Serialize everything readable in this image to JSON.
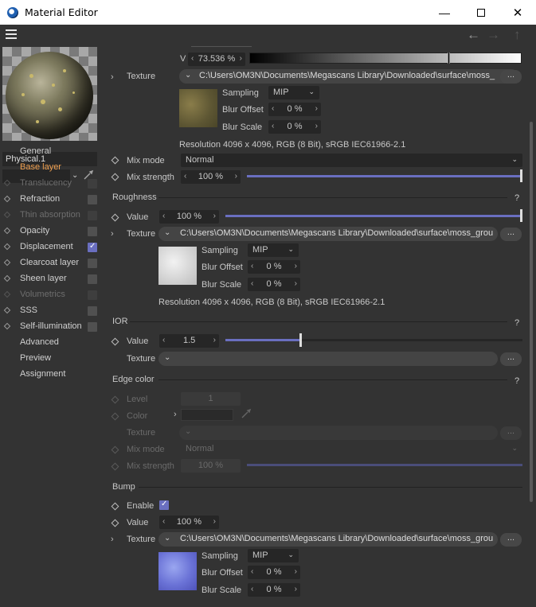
{
  "window": {
    "title": "Material Editor"
  },
  "material": {
    "name": "Physical.1"
  },
  "sidebar": {
    "items": [
      {
        "label": "General",
        "state": "normal"
      },
      {
        "label": "Base layer",
        "state": "active"
      },
      {
        "label": "Translucency",
        "state": "disabled"
      },
      {
        "label": "Refraction",
        "state": "normal"
      },
      {
        "label": "Thin absorption",
        "state": "disabled"
      },
      {
        "label": "Opacity",
        "state": "normal"
      },
      {
        "label": "Displacement",
        "state": "normal",
        "checked": true
      },
      {
        "label": "Clearcoat layer",
        "state": "normal"
      },
      {
        "label": "Sheen layer",
        "state": "normal"
      },
      {
        "label": "Volumetrics",
        "state": "disabled"
      },
      {
        "label": "SSS",
        "state": "normal"
      },
      {
        "label": "Self-illumination",
        "state": "normal"
      },
      {
        "label": "Advanced",
        "state": "normal"
      },
      {
        "label": "Preview",
        "state": "normal"
      },
      {
        "label": "Assignment",
        "state": "normal"
      }
    ]
  },
  "base": {
    "v_label": "V",
    "v_value": "73.536 %",
    "v_fraction": 0.735,
    "texture_label": "Texture",
    "texture_path": "C:\\Users\\OM3N\\Documents\\Megascans Library\\Downloaded\\surface\\moss_",
    "sampling_label": "Sampling",
    "sampling_value": "MIP",
    "blur_offset_label": "Blur Offset",
    "blur_offset_value": "0 %",
    "blur_scale_label": "Blur Scale",
    "blur_scale_value": "0 %",
    "resolution": "Resolution 4096 x 4096, RGB (8 Bit), sRGB IEC61966-2.1",
    "mix_mode_label": "Mix mode",
    "mix_mode_value": "Normal",
    "mix_strength_label": "Mix strength",
    "mix_strength_value": "100 %",
    "mix_strength_fraction": 1.0,
    "more": "..."
  },
  "roughness": {
    "title": "Roughness",
    "help": "?",
    "value_label": "Value",
    "value": "100 %",
    "fraction": 1.0,
    "texture_label": "Texture",
    "texture_path": "C:\\Users\\OM3N\\Documents\\Megascans Library\\Downloaded\\surface\\moss_grou",
    "sampling_label": "Sampling",
    "sampling_value": "MIP",
    "blur_offset_label": "Blur Offset",
    "blur_offset_value": "0 %",
    "blur_scale_label": "Blur Scale",
    "blur_scale_value": "0 %",
    "resolution": "Resolution 4096 x 4096, RGB (8 Bit), sRGB IEC61966-2.1",
    "more": "..."
  },
  "ior": {
    "title": "IOR",
    "help": "?",
    "value_label": "Value",
    "value": "1.5",
    "fraction": 0.25,
    "texture_label": "Texture",
    "more": "..."
  },
  "edge_color": {
    "title": "Edge color",
    "help": "?",
    "level_label": "Level",
    "level_value": "1",
    "color_label": "Color",
    "texture_label": "Texture",
    "mix_mode_label": "Mix mode",
    "mix_mode_value": "Normal",
    "mix_strength_label": "Mix strength",
    "mix_strength_value": "100 %",
    "more": "..."
  },
  "bump": {
    "title": "Bump",
    "enable_label": "Enable",
    "value_label": "Value",
    "value": "100 %",
    "texture_label": "Texture",
    "texture_path": "C:\\Users\\OM3N\\Documents\\Megascans Library\\Downloaded\\surface\\moss_grou",
    "sampling_label": "Sampling",
    "sampling_value": "MIP",
    "blur_offset_label": "Blur Offset",
    "blur_offset_value": "0 %",
    "blur_scale_label": "Blur Scale",
    "blur_scale_value": "0 %",
    "more": "..."
  },
  "colors": {
    "accent": "#6a6fc0",
    "active": "#f0a050",
    "bg": "#333333"
  }
}
